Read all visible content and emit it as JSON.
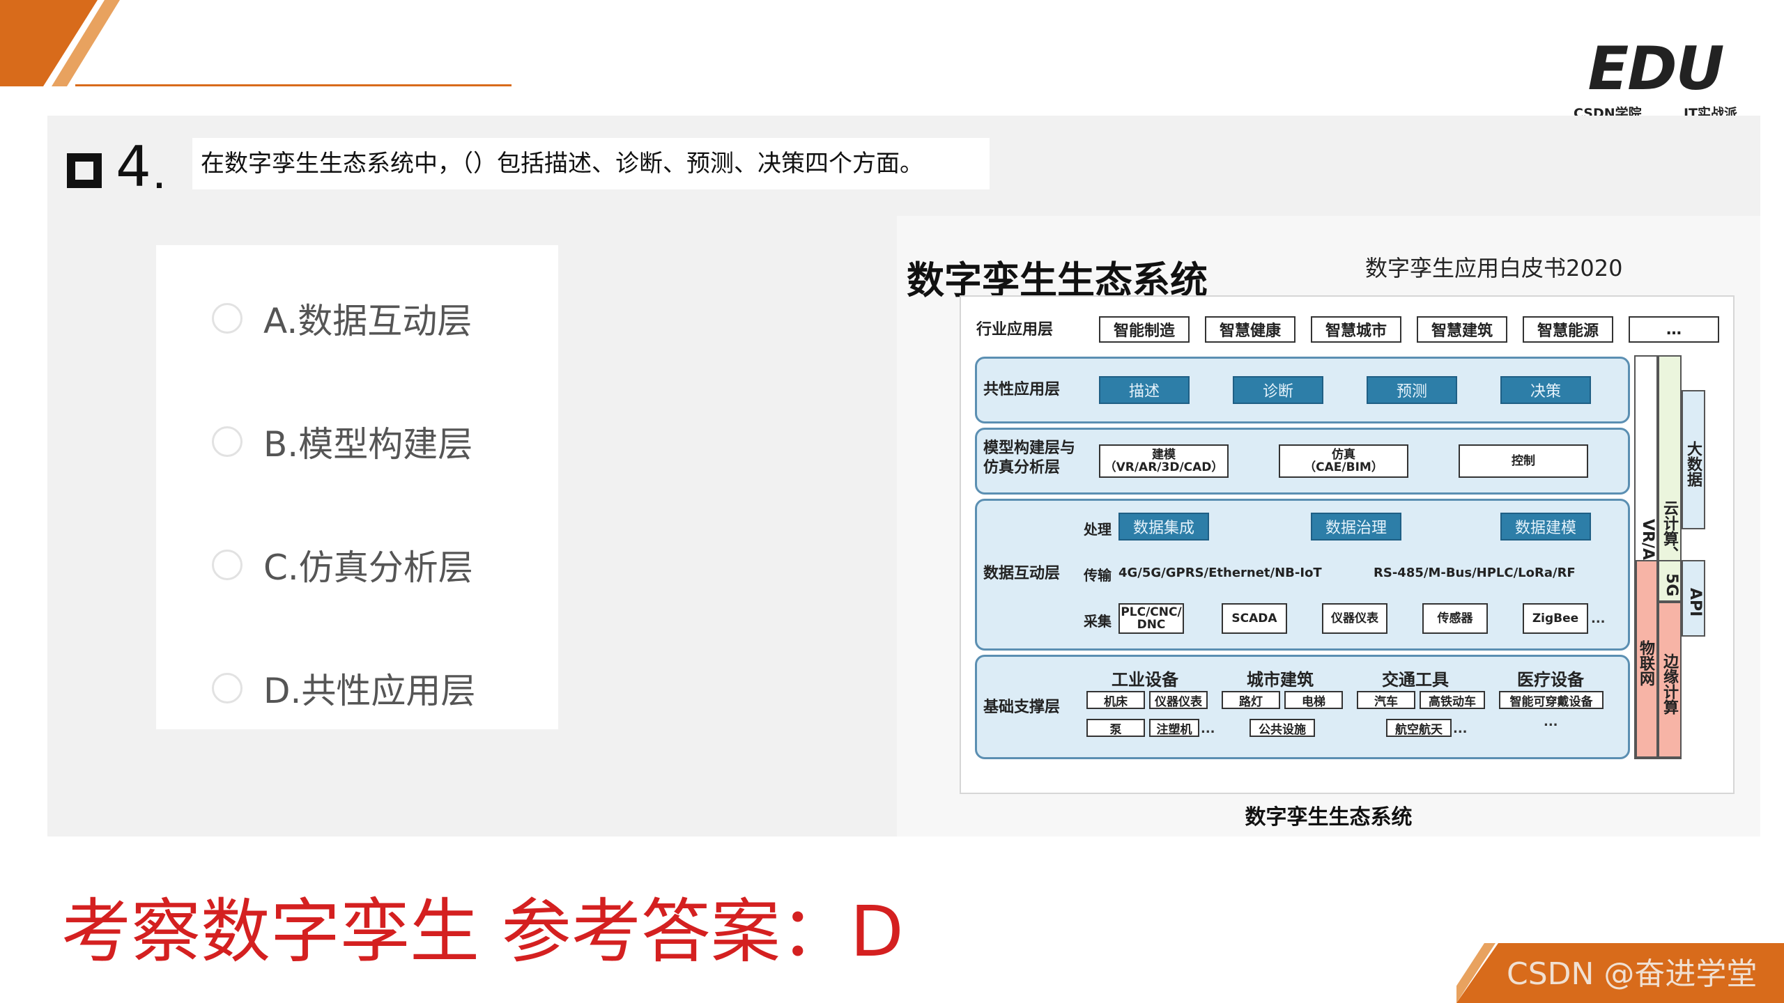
{
  "colors": {
    "accent": "#d86b1b",
    "answer": "#d42020",
    "layer_blue": "#2d7ea8",
    "band_fill": "#dcecf6",
    "panel": "#f1f1f1"
  },
  "logo": {
    "text": "EDU",
    "left": "CSDN学院",
    "right": "IT实战派"
  },
  "question": {
    "number": "4",
    "text": "在数字孪生生态系统中，（）包括描述、诊断、预测、决策四个方面。",
    "options": [
      {
        "label": "A.数据互动层"
      },
      {
        "label": "B.模型构建层"
      },
      {
        "label": "C.仿真分析层"
      },
      {
        "label": "D.共性应用层"
      }
    ]
  },
  "diagram": {
    "title": "数字孪生生态系统",
    "source": "数字孪生应用白皮书2020",
    "caption": "数字孪生生态系统",
    "industry_layer": {
      "label": "行业应用层",
      "items": [
        "智能制造",
        "智慧健康",
        "智慧城市",
        "智慧建筑",
        "智慧能源",
        "…"
      ]
    },
    "common_layer": {
      "label": "共性应用层",
      "items": [
        "描述",
        "诊断",
        "预测",
        "决策"
      ]
    },
    "model_layer": {
      "label_line1": "模型构建层与",
      "label_line2": "仿真分析层",
      "items": [
        {
          "line1": "建模",
          "line2": "（VR/AR/3D/CAD）"
        },
        {
          "line1": "仿真",
          "line2": "（CAE/BIM）"
        },
        {
          "line1": "控制",
          "line2": ""
        }
      ]
    },
    "data_layer": {
      "label": "数据互动层",
      "process_label": "处理",
      "process_items": [
        "数据集成",
        "数据治理",
        "数据建模"
      ],
      "transfer_label": "传输",
      "transfer_left": "4G/5G/GPRS/Ethernet/NB-IoT",
      "transfer_right": "RS-485/M-Bus/HPLC/LoRa/RF",
      "collect_label": "采集",
      "collect_items": [
        {
          "line1": "PLC/CNC/",
          "line2": "DNC"
        },
        {
          "line1": "SCADA",
          "line2": ""
        },
        {
          "line1": "仪器仪表",
          "line2": ""
        },
        {
          "line1": "传感器",
          "line2": ""
        },
        {
          "line1": "ZigBee",
          "line2": ""
        }
      ],
      "collect_more": "..."
    },
    "base_layer": {
      "label": "基础支撑层",
      "categories": [
        {
          "title": "工业设备",
          "row1": [
            "机床",
            "仪器仪表"
          ],
          "row2": [
            "泵",
            "注塑机"
          ],
          "more": "..."
        },
        {
          "title": "城市建筑",
          "row1": [
            "路灯",
            "电梯"
          ],
          "row2": [
            "公共设施"
          ],
          "more": ""
        },
        {
          "title": "交通工具",
          "row1": [
            "汽车",
            "高铁动车"
          ],
          "row2": [
            "航空航天"
          ],
          "more": "..."
        },
        {
          "title": "医疗设备",
          "row1": [
            "智能可穿戴设备"
          ],
          "row2": [],
          "more": "..."
        }
      ]
    },
    "side_columns": {
      "vr": "VR/AR/MR",
      "iot": "物联网",
      "ai": "云计算、人工智能",
      "five_g": "5G",
      "edge": "边缘计算",
      "bigdata": "大数据",
      "api": "API"
    }
  },
  "answer": {
    "text": "考察数字孪生  参考答案：D"
  },
  "watermark": {
    "text": "CSDN @奋进学堂"
  }
}
